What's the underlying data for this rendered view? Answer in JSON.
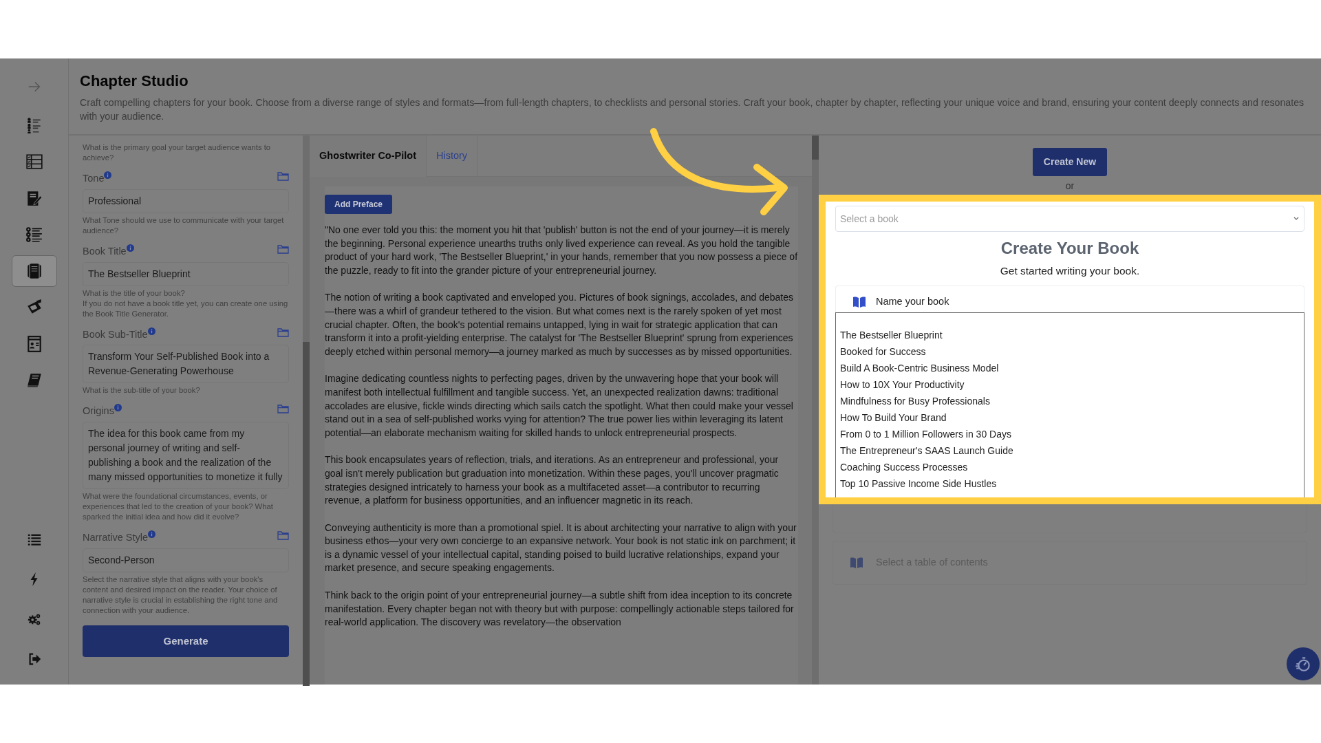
{
  "sidebar": {
    "top_items": [
      {
        "selected": false
      },
      {
        "selected": false
      },
      {
        "selected": false
      },
      {
        "selected": false
      },
      {
        "selected": true
      },
      {
        "selected": false
      },
      {
        "selected": false
      },
      {
        "selected": false
      }
    ],
    "bottom_items": [
      {
        "selected": false
      },
      {
        "selected": false
      },
      {
        "selected": false
      },
      {
        "selected": false
      }
    ]
  },
  "header": {
    "title": "Chapter Studio",
    "description": "Craft compelling chapters for your book. Choose from a diverse range of styles and formats—from full-length chapters, to checklists and personal stories. Craft your book, chapter by chapter, reflecting your unique voice and brand, ensuring your content deeply connects and resonates with your audience."
  },
  "form": {
    "top_help": "What is the primary goal your target audience wants to achieve?",
    "fields": [
      {
        "label": "Tone",
        "value": "Professional",
        "help": [
          "What Tone should we use to communicate with your target audience?"
        ]
      },
      {
        "label": "Book Title",
        "value": "The Bestseller Blueprint",
        "help": [
          "What is the title of your book?",
          "If you do not have a book title yet, you can create one using the Book Title Generator."
        ]
      },
      {
        "label": "Book Sub-Title",
        "value": "Transform Your Self-Published Book into a Revenue-Generating Powerhouse",
        "help": [
          "What is the sub-title of your book?"
        ]
      },
      {
        "label": "Origins",
        "value": "The idea for this book came from my personal journey of writing and self-publishing a book and the realization of the many missed opportunities to monetize it fully",
        "help": [
          "What were the foundational circumstances, events, or experiences that led to the creation of your book? What sparked the initial idea and how did it evolve?"
        ]
      },
      {
        "label": "Narrative Style",
        "value": "Second-Person",
        "help": [
          "Select the narrative style that aligns with your book's content and desired impact on the reader. Your choice of narrative style is crucial in establishing the right tone and connection with your audience."
        ]
      }
    ],
    "generate_button": "Generate"
  },
  "editor": {
    "tabs": [
      {
        "label": "Ghostwriter Co-Pilot",
        "selected": true
      },
      {
        "label": "History",
        "selected": false
      }
    ],
    "add_preface_button": "Add Preface",
    "paragraphs": [
      "\"No one ever told you this: the moment you hit that 'publish' button is not the end of your journey—it is merely the beginning. Personal experience unearths truths only lived experience can reveal. As you hold the tangible product of your hard work, 'The Bestseller Blueprint,' in your hands, remember that you now possess a piece of the puzzle, ready to fit into the grander picture of your entrepreneurial journey.",
      "The notion of writing a book captivated and enveloped you. Pictures of book signings, accolades, and debates—there was a whirl of grandeur tethered to the vision. But what comes next is the rarely spoken of yet most crucial chapter. Often, the book's potential remains untapped, lying in wait for strategic application that can transform it into a profit-yielding enterprise. The catalyst for 'The Bestseller Blueprint' sprung from experiences deeply etched within personal memory—a journey marked as much by successes as by missed opportunities.",
      "Imagine dedicating countless nights to perfecting pages, driven by the unwavering hope that your book will manifest both intellectual fulfillment and tangible success. Yet, an unexpected realization dawns: traditional accolades are elusive, fickle winds directing which sails catch the spotlight. What then could make your vessel stand out in a sea of self-published works vying for attention? The true power lies within leveraging its latent potential—an elaborate mechanism waiting for skilled hands to unlock entrepreneurial prospects.",
      "This book encapsulates years of reflection, trials, and iterations. As an entrepreneur and professional, your goal isn't merely publication but graduation into monetization. Within these pages, you'll uncover pragmatic strategies designed intricately to harness your book as a multifaceted asset—a contributor to recurring revenue, a platform for business opportunities, and an influencer magnetic in its reach.",
      "Conveying authenticity is more than a promotional spiel. It is about architecting your narrative to align with your business ethos—your very own concierge to an expansive network. Your book is not static ink on parchment; it is a dynamic vessel of your intellectual capital, standing poised to build lucrative relationships, expand your market presence, and secure speaking engagements.",
      "Think back to the origin point of your entrepreneurial journey—a subtle shift from idea inception to its concrete manifestation. Every chapter began not with theory but with purpose: compellingly actionable steps tailored for real-world application. The discovery was revelatory—the observation"
    ]
  },
  "book_panel": {
    "create_button": "Create New",
    "or_text": "or",
    "select": {
      "placeholder": "Select a book"
    },
    "heading": "Create Your Book",
    "subheading": "Get started writing your book.",
    "name_card_title": "Name your book",
    "book_list": [
      "The Bestseller Blueprint",
      "Booked for Success",
      "Build A Book-Centric Business Model",
      "How to 10X Your Productivity",
      "Mindfulness for Busy Professionals",
      "How To Build Your Brand",
      "From 0 to 1 Million Followers in 30 Days",
      "The Entrepreneur's SAAS Launch Guide",
      "Coaching Success Processes",
      "Top 10 Passive Income Side Hustles"
    ],
    "toc_card_title": "Select a table of contents"
  }
}
